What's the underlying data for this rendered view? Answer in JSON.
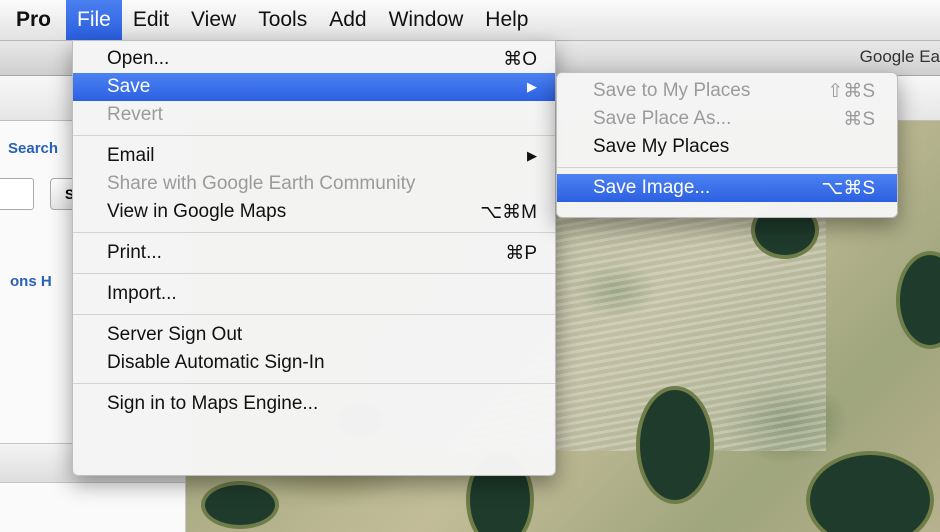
{
  "menubar": {
    "items": [
      {
        "label": "Pro"
      },
      {
        "label": "File"
      },
      {
        "label": "Edit"
      },
      {
        "label": "View"
      },
      {
        "label": "Tools"
      },
      {
        "label": "Add"
      },
      {
        "label": "Window"
      },
      {
        "label": "Help"
      }
    ]
  },
  "window": {
    "title": "Google Ea"
  },
  "sidebar": {
    "search_label": "Search",
    "search_button_label": "S",
    "tabs_label": "ons  H"
  },
  "file_menu": {
    "items": [
      {
        "label": "Open...",
        "shortcut": "⌘O"
      },
      {
        "label": "Save",
        "shortcut": "▶"
      },
      {
        "label": "Revert",
        "shortcut": ""
      },
      {
        "label": "Email",
        "shortcut": "▶"
      },
      {
        "label": "Share with Google Earth Community",
        "shortcut": ""
      },
      {
        "label": "View in Google Maps",
        "shortcut": "⌥⌘M"
      },
      {
        "label": "Print...",
        "shortcut": "⌘P"
      },
      {
        "label": "Import...",
        "shortcut": ""
      },
      {
        "label": "Server Sign Out",
        "shortcut": ""
      },
      {
        "label": "Disable Automatic Sign-In",
        "shortcut": ""
      },
      {
        "label": "Sign in to Maps Engine...",
        "shortcut": ""
      }
    ]
  },
  "save_submenu": {
    "items": [
      {
        "label": "Save to My Places",
        "shortcut": "⇧⌘S"
      },
      {
        "label": "Save Place As...",
        "shortcut": "⌘S"
      },
      {
        "label": "Save My Places",
        "shortcut": ""
      },
      {
        "label": "Save Image...",
        "shortcut": "⌥⌘S"
      }
    ]
  },
  "colors": {
    "highlight": "#2c60e2",
    "disabled_text": "#9b9b9b"
  }
}
